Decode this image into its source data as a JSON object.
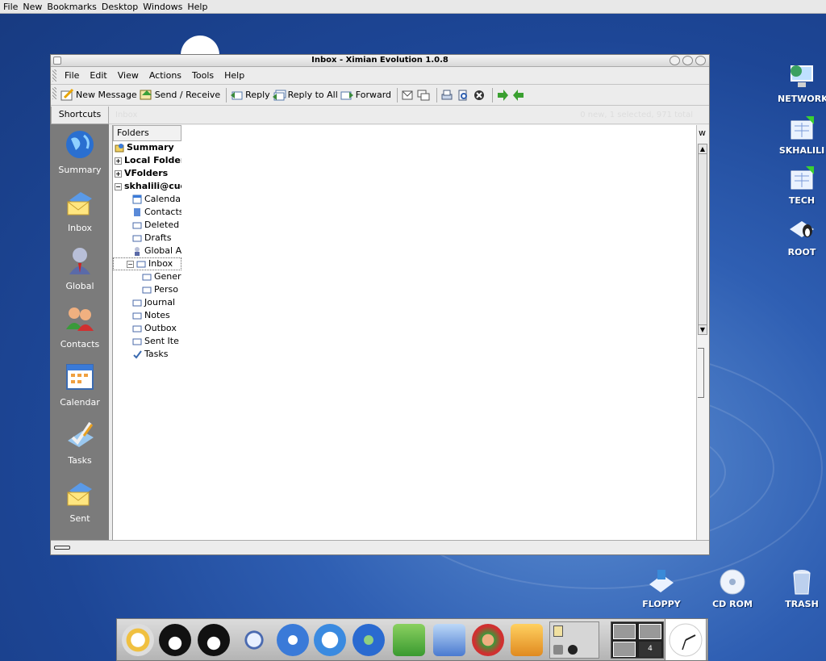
{
  "top_menu": [
    "File",
    "New",
    "Bookmarks",
    "Desktop",
    "Windows",
    "Help"
  ],
  "window": {
    "title": "Inbox - Ximian Evolution 1.0.8",
    "menu": [
      "File",
      "Edit",
      "View",
      "Actions",
      "Tools",
      "Help"
    ],
    "toolbar": {
      "new_message": "New Message",
      "send_receive": "Send / Receive",
      "reply": "Reply",
      "reply_all": "Reply to All",
      "forward": "Forward"
    },
    "path_title": "Inbox",
    "status": "0 new, 1 selected, 971 total"
  },
  "shortcuts": {
    "header": "Shortcuts",
    "items": [
      "Summary",
      "Inbox",
      "Global",
      "Contacts",
      "Calendar",
      "Tasks",
      "Sent"
    ]
  },
  "folders": {
    "header": "Folders",
    "top": [
      "Summary",
      "Local Folders",
      "VFolders",
      "skhalili@cucl"
    ],
    "sub": [
      "Calenda",
      "Contacts",
      "Deleted",
      "Drafts",
      "Global A",
      "Inbox",
      "Gener",
      "Perso",
      "Journal",
      "Notes",
      "Outbox",
      "Sent Ite",
      "Tasks"
    ]
  },
  "right_col_label": "w",
  "desktop_icons": [
    "NETWORK",
    "SKHALILI",
    "TECH",
    "ROOT",
    "FLOPPY",
    "CD ROM",
    "TRASH"
  ],
  "pager_number": "4",
  "colors": {
    "accent": "#2f5fb3",
    "shortcut_bg": "#7b7b7b"
  }
}
